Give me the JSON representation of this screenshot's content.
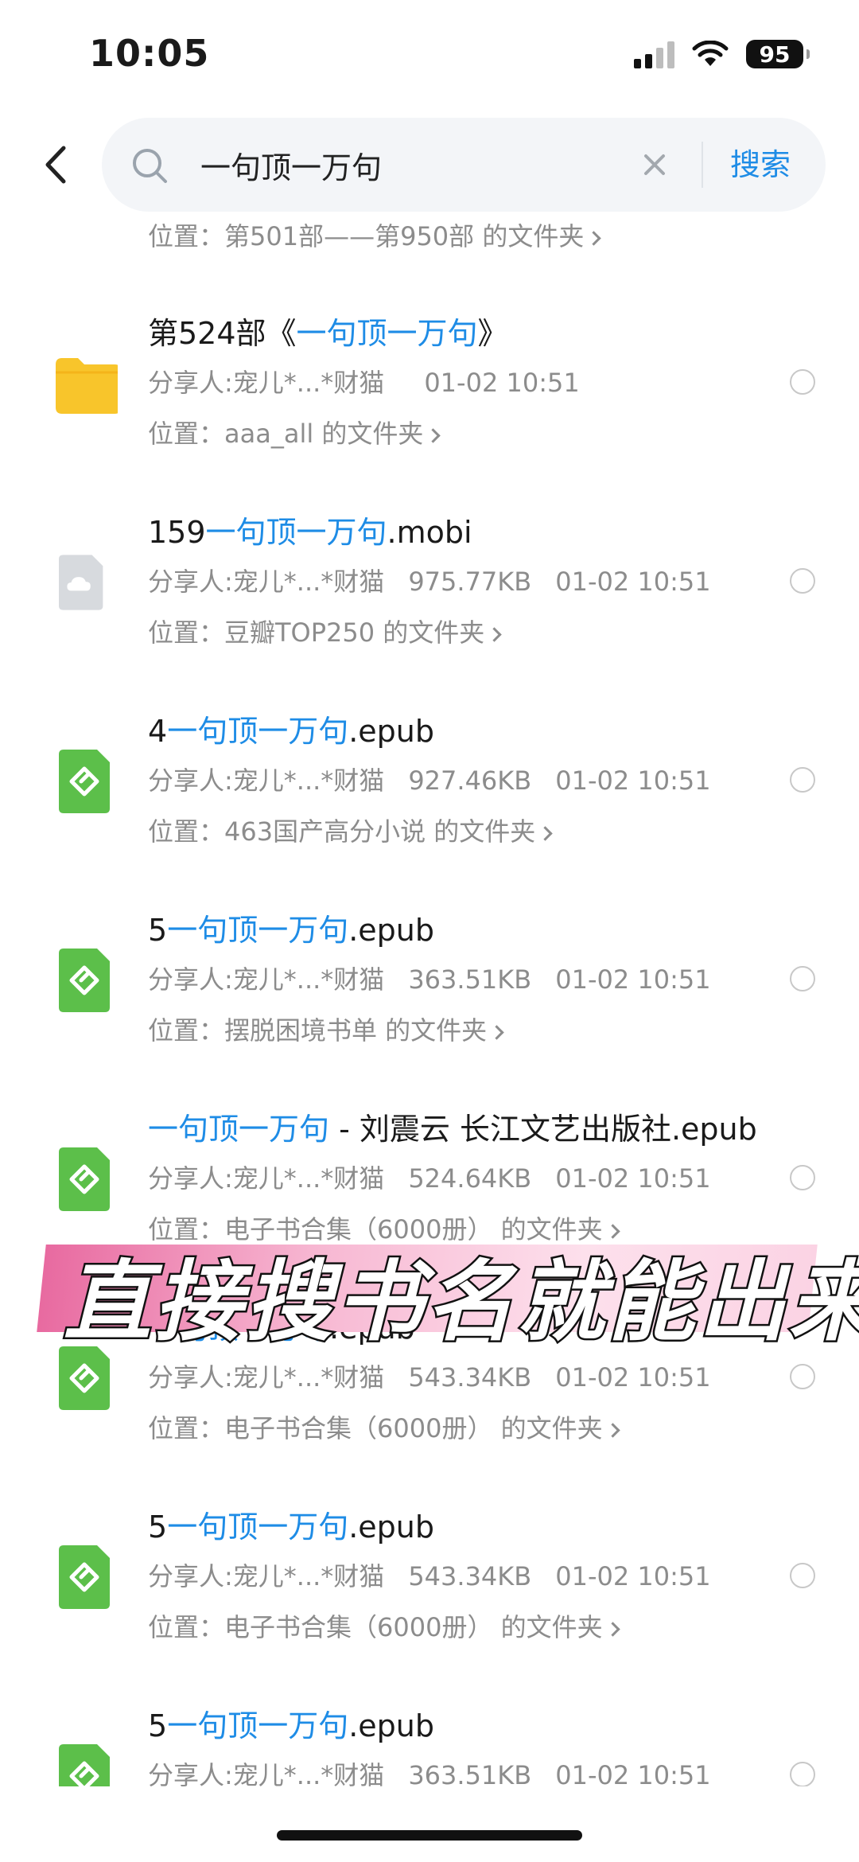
{
  "status": {
    "time": "10:05",
    "battery": "95"
  },
  "search": {
    "query": "一句顶一万句",
    "button_label": "搜索"
  },
  "top_location": "位置：第501部——第950部 的文件夹",
  "items": [
    {
      "type": "folder",
      "title_prefix": "第524部《",
      "title_highlight": "一句顶一万句",
      "title_suffix": "》",
      "sharer": "分享人:宠儿*...*财猫",
      "size": "",
      "date": "01-02 10:51",
      "location": "位置：aaa_all 的文件夹"
    },
    {
      "type": "cloud",
      "title_prefix": "159",
      "title_highlight": "一句顶一万句",
      "title_suffix": ".mobi",
      "sharer": "分享人:宠儿*...*财猫",
      "size": "975.77KB",
      "date": "01-02 10:51",
      "location": "位置：豆瓣TOP250 的文件夹"
    },
    {
      "type": "epub",
      "title_prefix": "4",
      "title_highlight": "一句顶一万句",
      "title_suffix": ".epub",
      "sharer": "分享人:宠儿*...*财猫",
      "size": "927.46KB",
      "date": "01-02 10:51",
      "location": "位置：463国产高分小说 的文件夹"
    },
    {
      "type": "epub",
      "title_prefix": "5",
      "title_highlight": "一句顶一万句",
      "title_suffix": ".epub",
      "sharer": "分享人:宠儿*...*财猫",
      "size": "363.51KB",
      "date": "01-02 10:51",
      "location": "位置：摆脱困境书单 的文件夹"
    },
    {
      "type": "epub",
      "title_prefix": "",
      "title_highlight": "一句顶一万句",
      "title_suffix": " - 刘震云 长江文艺出版社.epub",
      "sharer": "分享人:宠儿*...*财猫",
      "size": "524.64KB",
      "date": "01-02 10:51",
      "location": "位置：电子书合集（6000册） 的文件夹"
    },
    {
      "type": "epub",
      "title_prefix": "",
      "title_highlight": "一句顶一万句",
      "title_suffix": ".epub",
      "sharer": "分享人:宠儿*...*财猫",
      "size": "543.34KB",
      "date": "01-02 10:51",
      "location": "位置：电子书合集（6000册） 的文件夹"
    },
    {
      "type": "epub",
      "title_prefix": "5",
      "title_highlight": "一句顶一万句",
      "title_suffix": ".epub",
      "sharer": "分享人:宠儿*...*财猫",
      "size": "543.34KB",
      "date": "01-02 10:51",
      "location": "位置：电子书合集（6000册） 的文件夹"
    },
    {
      "type": "epub",
      "title_prefix": "5",
      "title_highlight": "一句顶一万句",
      "title_suffix": ".epub",
      "sharer": "分享人:宠儿*...*财猫",
      "size": "363.51KB",
      "date": "01-02 10:51",
      "location": ""
    }
  ],
  "overlay_caption": "直接搜书名就能出来",
  "colors": {
    "accent": "#1e8ce6",
    "epub_green": "#5cbf4a",
    "folder_yellow": "#f8c52b"
  }
}
